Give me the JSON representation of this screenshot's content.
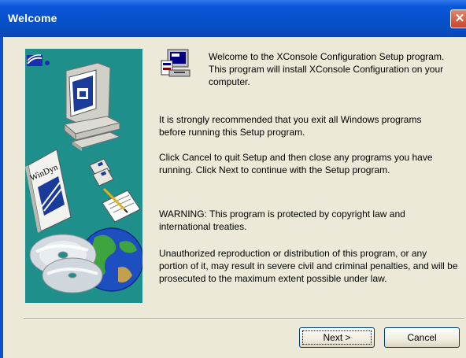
{
  "window": {
    "title": "Welcome",
    "close_label": "✕"
  },
  "sidebar": {
    "book_label": "WinDyn"
  },
  "messages": {
    "welcome": "Welcome to the XConsole Configuration Setup program.  This program will install XConsole Configuration on your computer.",
    "recommend": "It is strongly recommended that you exit all Windows programs before running this Setup program.",
    "cancel_info": "Click Cancel to quit Setup and then close any programs you have running.  Click Next to continue with the Setup program.",
    "warning": "WARNING: This program is protected by copyright law and international treaties.",
    "unauthorized": "Unauthorized reproduction or distribution of this program, or any portion of it, may result in severe civil and criminal penalties, and will be prosecuted to the maximum extent possible under law."
  },
  "buttons": {
    "next": "Next >",
    "cancel": "Cancel"
  },
  "colors": {
    "title_bar": "#0651c9",
    "dialog_bg": "#ece9d8",
    "sidebar_bg": "#1f8f8c",
    "close_button": "#c8462a"
  }
}
